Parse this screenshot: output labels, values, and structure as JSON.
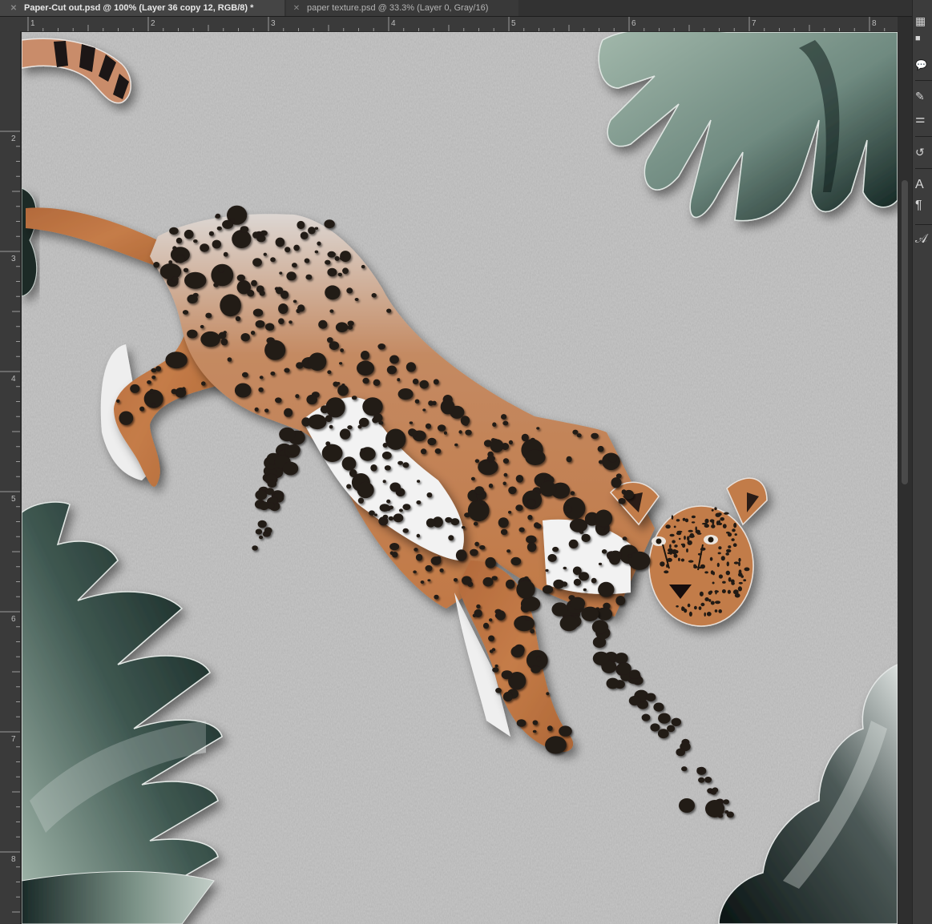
{
  "tabs": [
    {
      "label": "Paper-Cut out.psd @ 100% (Layer 36 copy 12, RGB/8) *",
      "active": true,
      "close_icon": "close-icon"
    },
    {
      "label": "paper texture.psd @ 33.3% (Layer 0, Gray/16)",
      "active": false,
      "close_icon": "close-icon"
    }
  ],
  "rulers": {
    "horizontal_ticks": [
      "1",
      "2",
      "3",
      "4",
      "5",
      "6",
      "7",
      "8"
    ],
    "vertical_ticks": [
      "2",
      "3",
      "4",
      "5",
      "6",
      "7",
      "8"
    ]
  },
  "panel_tools": [
    {
      "name": "properties-icon",
      "glyph": "▦"
    },
    {
      "name": "adjustments-icon",
      "glyph": "■"
    },
    {
      "name": "comment-icon",
      "glyph": "💬"
    },
    {
      "name": "brush-icon",
      "glyph": "✎"
    },
    {
      "name": "sliders-icon",
      "glyph": "⚌"
    },
    {
      "name": "history-icon",
      "glyph": "↺"
    },
    {
      "name": "character-icon",
      "glyph": "A"
    },
    {
      "name": "paragraph-icon",
      "glyph": "¶"
    },
    {
      "name": "glyphs-icon",
      "glyph": "𝒜"
    }
  ],
  "colors": {
    "paper": "#b4b4b4",
    "cheetah_fur": "#c57a45",
    "cheetah_spot": "#211a14",
    "leaf_light": "#91a89c",
    "leaf_dark": "#0d1c1a"
  }
}
